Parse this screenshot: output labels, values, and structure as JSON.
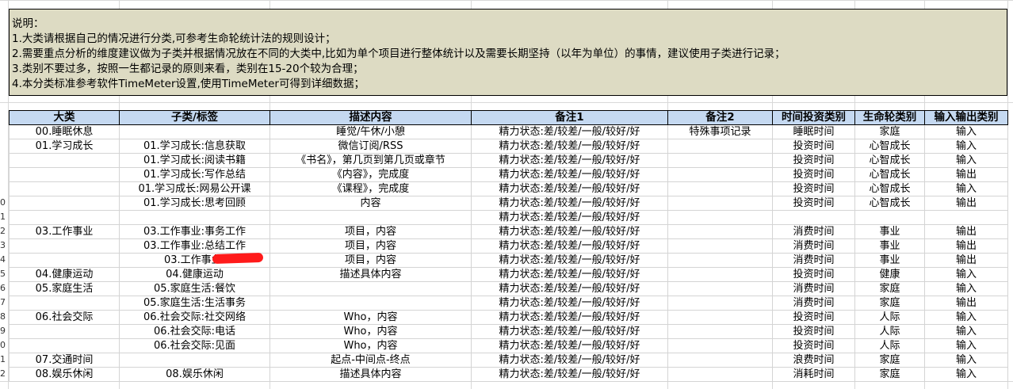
{
  "note": {
    "lines": [
      "说明：",
      "1.大类请根据自己的情况进行分类,可参考生命轮统计法的规则设计；",
      "2.需要重点分析的维度建议做为子类并根据情况放在不同的大类中,比如为单个项目进行整体统计以及需要长期坚持（以年为单位）的事情，建议使用子类进行记录；",
      "3.类别不要过多，按照一生都记录的原则来看，类别在15-20个较为合理；",
      "4.本分类标准参考软件TimeMeter设置,使用TimeMeter可得到详细数据；"
    ]
  },
  "table": {
    "headers": [
      "大类",
      "子类/标签",
      "描述内容",
      "备注1",
      "备注2",
      "时间投资类别",
      "生命轮类别",
      "输入输出类别"
    ],
    "rows": [
      [
        "00.睡眠休息",
        "",
        "睡觉/午休/小憩",
        "精力状态:差/较差/一般/较好/好",
        "特殊事项记录",
        "睡眠时间",
        "家庭",
        "输入"
      ],
      [
        "01.学习成长",
        "01.学习成长:信息获取",
        "微信订阅/RSS",
        "精力状态:差/较差/一般/较好/好",
        "",
        "投资时间",
        "心智成长",
        "输入"
      ],
      [
        "",
        "01.学习成长:阅读书籍",
        "《书名》，第几页到第几页或章节",
        "精力状态:差/较差/一般/较好/好",
        "",
        "投资时间",
        "心智成长",
        "输入"
      ],
      [
        "",
        "01.学习成长:写作总结",
        "《内容》，完成度",
        "精力状态:差/较差/一般/较好/好",
        "",
        "投资时间",
        "心智成长",
        "输出"
      ],
      [
        "",
        "01.学习成长:网易公开课",
        "《课程》，完成度",
        "精力状态:差/较差/一般/较好/好",
        "",
        "投资时间",
        "心智成长",
        "输入"
      ],
      [
        "",
        "01.学习成长:思考回顾",
        "内容",
        "精力状态:差/较差/一般/较好/好",
        "",
        "投资时间",
        "心智成长",
        "输出"
      ],
      [
        "",
        "",
        "",
        "精力状态:差/较差/一般/较好/好",
        "",
        "",
        "",
        ""
      ],
      [
        "03.工作事业",
        "03.工作事业:事务工作",
        "项目，内容",
        "精力状态:差/较差/一般/较好/好",
        "",
        "消费时间",
        "事业",
        "输出"
      ],
      [
        "",
        "03.工作事业:总结工作",
        "项目，内容",
        "精力状态:差/较差/一般/较好/好",
        "",
        "消费时间",
        "事业",
        "输出"
      ],
      [
        "",
        "03.工作事业:",
        "项目，内容",
        "精力状态:差/较差/一般/较好/好",
        "",
        "消费时间",
        "事业",
        "输出"
      ],
      [
        "04.健康运动",
        "04.健康运动",
        "描述具体内容",
        "精力状态:差/较差/一般/较好/好",
        "",
        "投资时间",
        "健康",
        "输入"
      ],
      [
        "05.家庭生活",
        "05.家庭生活:餐饮",
        "",
        "精力状态:差/较差/一般/较好/好",
        "",
        "消费时间",
        "家庭",
        "输入"
      ],
      [
        "",
        "05.家庭生活:生活事务",
        "",
        "精力状态:差/较差/一般/较好/好",
        "",
        "消费时间",
        "家庭",
        "输出"
      ],
      [
        "06.社会交际",
        "06.社会交际:社交网络",
        "Who，内容",
        "精力状态:差/较差/一般/较好/好",
        "",
        "投资时间",
        "人际",
        "输入"
      ],
      [
        "",
        "06.社会交际:电话",
        "Who，内容",
        "精力状态:差/较差/一般/较好/好",
        "",
        "投资时间",
        "人际",
        "输入"
      ],
      [
        "",
        "06.社会交际:见面",
        "Who，内容",
        "精力状态:差/较差/一般/较好/好",
        "",
        "投资时间",
        "人际",
        "输入"
      ],
      [
        "07.交通时间",
        "",
        "起点-中间点-终点",
        "精力状态:差/较差/一般/较好/好",
        "",
        "浪费时间",
        "家庭",
        "输入"
      ],
      [
        "08.娱乐休闲",
        "08.娱乐休闲",
        "描述具体内容",
        "精力状态:差/较差/一般/较好/好",
        "",
        "消耗时间",
        "家庭",
        "输入"
      ]
    ]
  },
  "row_numbers": [
    "",
    "",
    "",
    "",
    "",
    "0",
    "1",
    "2",
    "3",
    "4",
    "5",
    "6",
    "7",
    "8",
    "9",
    "0",
    "1",
    "2"
  ],
  "colors": {
    "header_bg": "#c5d9f1",
    "note_bg": "#dddbc3",
    "redaction": "#ff1a1a"
  }
}
